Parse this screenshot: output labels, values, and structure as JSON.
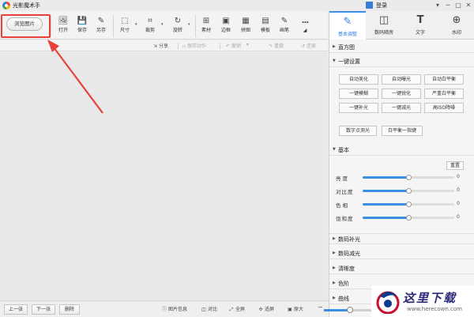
{
  "app": {
    "title": "光影魔术手",
    "login": "登录"
  },
  "window_controls": [
    "▾",
    "─",
    "□",
    "✕"
  ],
  "toolbar": {
    "browse_label": "浏览图片",
    "buttons": [
      {
        "label": "打开",
        "icon": "open-icon",
        "glyph": "🖼"
      },
      {
        "label": "保存",
        "icon": "save-icon",
        "glyph": "💾"
      },
      {
        "label": "另存",
        "icon": "save-as-icon",
        "glyph": "✎"
      },
      {
        "label": "尺寸",
        "icon": "resize-icon",
        "glyph": "⬚"
      },
      {
        "label": "裁剪",
        "icon": "crop-icon",
        "glyph": "⌗"
      },
      {
        "label": "旋转",
        "icon": "rotate-icon",
        "glyph": "↻"
      },
      {
        "label": "素材",
        "icon": "material-icon",
        "glyph": "⊞"
      },
      {
        "label": "边框",
        "icon": "border-icon",
        "glyph": "▣"
      },
      {
        "label": "拼图",
        "icon": "collage-icon",
        "glyph": "▦"
      },
      {
        "label": "模板",
        "icon": "template-icon",
        "glyph": "▤"
      },
      {
        "label": "画笔",
        "icon": "brush-icon",
        "glyph": "✎"
      },
      {
        "label": "...",
        "icon": "more-icon",
        "glyph": ""
      }
    ]
  },
  "actionbar": {
    "share": "分享",
    "save_action": "保存动作",
    "undo": "撤销",
    "redo": "重做",
    "restore": "还原"
  },
  "panel": {
    "tabs": [
      {
        "label": "基本调整",
        "icon": "adjust-icon",
        "glyph": "✎",
        "active": true
      },
      {
        "label": "数码暗房",
        "icon": "darkroom-icon",
        "glyph": "◫",
        "active": false
      },
      {
        "label": "文字",
        "icon": "text-icon",
        "glyph": "T",
        "active": false
      },
      {
        "label": "水印",
        "icon": "watermark-icon",
        "glyph": "⊕",
        "active": false
      }
    ],
    "histogram_label": "直方图",
    "one_click_label": "一键设置",
    "presets": [
      "自动美化",
      "自动曝光",
      "自动白平衡",
      "一键模糊",
      "一键锐化",
      "严重白平衡",
      "一键补光",
      "一键减光",
      "高ISO降噪"
    ],
    "extra_presets": [
      "数字点测光",
      "白平衡一指键"
    ],
    "basic_label": "基本",
    "reset_label": "重置",
    "sliders": [
      {
        "label": "亮度",
        "value": "0",
        "position": 0.5
      },
      {
        "label": "对比度",
        "value": "0",
        "position": 0.5
      },
      {
        "label": "色相",
        "value": "0",
        "position": 0.5
      },
      {
        "label": "饱和度",
        "value": "0",
        "position": 0.5
      }
    ],
    "collapsed_sections": [
      "数码补光",
      "数码减光",
      "清晰度",
      "色阶",
      "曲线"
    ]
  },
  "statusbar": {
    "prev": "上一张",
    "next": "下一张",
    "delete": "删除",
    "tools": [
      "图片信息",
      "对比",
      "全屏",
      "适屏",
      "原大"
    ],
    "zoom_position": 0.55
  },
  "watermark": {
    "text": "这里下载",
    "url": "www.herecown.com"
  }
}
